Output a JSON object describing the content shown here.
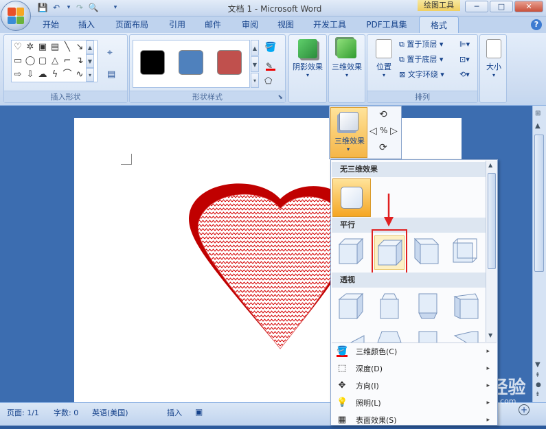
{
  "window": {
    "title": "文档 1 - Microsoft Word",
    "context_tab": "绘图工具",
    "min_glyph": "─",
    "max_glyph": "□",
    "close_glyph": "✕"
  },
  "tabs": [
    "开始",
    "插入",
    "页面布局",
    "引用",
    "邮件",
    "审阅",
    "视图",
    "开发工具",
    "PDF工具集",
    "格式"
  ],
  "help_glyph": "?",
  "ribbon": {
    "groups": {
      "insert_shapes": "插入形状",
      "shape_styles": "形状样式",
      "arrange": "排列"
    },
    "shadow_effects_label": "阴影效果",
    "three_d_effects_label": "三维效果",
    "position_label": "位置",
    "bring_to_front": "置于顶层",
    "send_to_back": "置于底层",
    "text_wrapping": "文字环绕",
    "size_label": "大小",
    "swatch_colors": [
      "#000000",
      "#4f81bd",
      "#c0504d"
    ]
  },
  "sub_panel": {
    "three_d_effects_label": "三维效果"
  },
  "menu": {
    "no_3d": "无三维效果",
    "parallel": "平行",
    "perspective": "透视",
    "items": [
      {
        "label": "三维颜色(C)",
        "arrow": "▸"
      },
      {
        "label": "深度(D)",
        "arrow": "▸"
      },
      {
        "label": "方向(I)",
        "arrow": "▸"
      },
      {
        "label": "照明(L)",
        "arrow": "▸"
      },
      {
        "label": "表面效果(S)",
        "arrow": "▸"
      }
    ]
  },
  "status": {
    "page": "页面: 1/1",
    "words": "字数: 0",
    "language": "英语(美国)",
    "mode": "插入"
  },
  "watermark": {
    "brand": "Bai du 经验",
    "url": "jingyan.baidu.com"
  },
  "colors": {
    "heart_red": "#d40000",
    "highlight_red": "#e02020",
    "accent_orange": "#f5a623"
  }
}
